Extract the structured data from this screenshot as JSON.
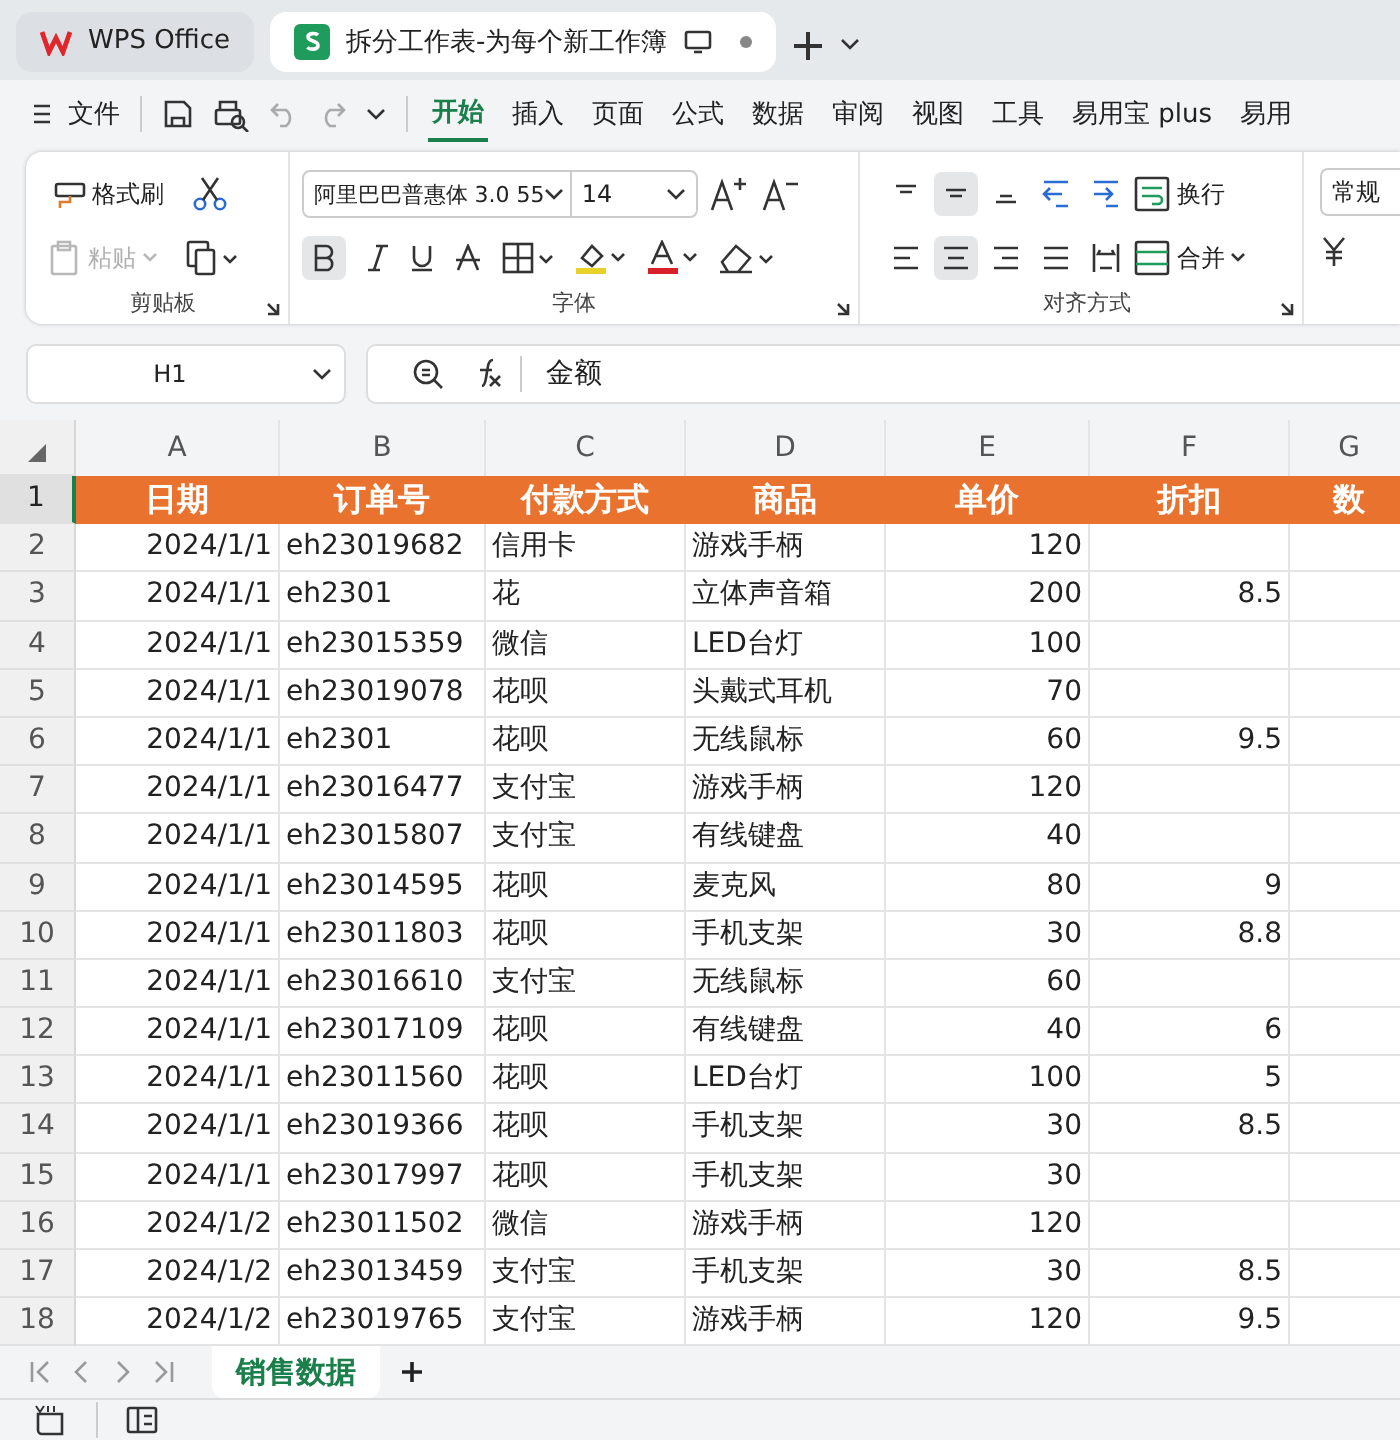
{
  "app_tabs": [
    {
      "label": "WPS Office",
      "kind": "home",
      "selected": false
    },
    {
      "label": "拆分工作表-为每个新工作簿",
      "kind": "sheet",
      "selected": true
    }
  ],
  "menu": "文件",
  "ribbon_tabs": [
    {
      "label": "开始",
      "selected": true
    },
    {
      "label": "插入",
      "selected": false
    },
    {
      "label": "页面",
      "selected": false
    },
    {
      "label": "公式",
      "selected": false
    },
    {
      "label": "数据",
      "selected": false
    },
    {
      "label": "审阅",
      "selected": false
    },
    {
      "label": "视图",
      "selected": false
    },
    {
      "label": "工具",
      "selected": false
    },
    {
      "label": "易用宝 plus",
      "selected": false
    },
    {
      "label": "易用",
      "selected": false
    }
  ],
  "clipboard": {
    "format_painter": "格式刷",
    "paste": "粘贴",
    "paste_disabled": true,
    "group": "剪贴板"
  },
  "font": {
    "name": "阿里巴巴普惠体 3.0 55",
    "size": "14",
    "bold": true,
    "group": "字体"
  },
  "alignment": {
    "top_row": [
      {
        "kind": "top",
        "selected": false
      },
      {
        "kind": "middle",
        "selected": true
      },
      {
        "kind": "bottom",
        "selected": false
      },
      {
        "kind": "outdent",
        "selected": false
      },
      {
        "kind": "indent",
        "selected": false
      }
    ],
    "bottom_row": [
      {
        "kind": "left",
        "selected": false
      },
      {
        "kind": "center",
        "selected": true
      },
      {
        "kind": "right",
        "selected": false
      },
      {
        "kind": "justify",
        "selected": false
      },
      {
        "kind": "distribute",
        "selected": false
      }
    ],
    "wrap": "换行",
    "merge": "合并",
    "group": "对齐方式"
  },
  "number": {
    "format": "常规"
  },
  "name_box": "H1",
  "formula": "金额",
  "columns": [
    "A",
    "B",
    "C",
    "D",
    "E",
    "F",
    "G"
  ],
  "header": {
    "n": "1",
    "cells": [
      "日期",
      "订单号",
      "付款方式",
      "商品",
      "单价",
      "折扣",
      "数"
    ]
  },
  "rows": [
    {
      "n": "2",
      "date": "2024/1/1",
      "order": "eh23019682",
      "pay": "信用卡",
      "item": "游戏手柄",
      "price": "120"
    },
    {
      "n": "3",
      "date": "2024/1/1",
      "order": "eh2301",
      "pay": "花",
      "item": "立体声音箱",
      "price": "200",
      "discount": "8.5"
    },
    {
      "n": "4",
      "date": "2024/1/1",
      "order": "eh23015359",
      "pay": "微信",
      "item": "LED台灯",
      "price": "100"
    },
    {
      "n": "5",
      "date": "2024/1/1",
      "order": "eh23019078",
      "pay": "花呗",
      "item": "头戴式耳机",
      "price": "70"
    },
    {
      "n": "6",
      "date": "2024/1/1",
      "order": "eh2301",
      "pay": "花呗",
      "item": "无线鼠标",
      "price": "60",
      "discount": "9.5"
    },
    {
      "n": "7",
      "date": "2024/1/1",
      "order": "eh23016477",
      "pay": "支付宝",
      "item": "游戏手柄",
      "price": "120"
    },
    {
      "n": "8",
      "date": "2024/1/1",
      "order": "eh23015807",
      "pay": "支付宝",
      "item": "有线键盘",
      "price": "40"
    },
    {
      "n": "9",
      "date": "2024/1/1",
      "order": "eh23014595",
      "pay": "花呗",
      "item": "麦克风",
      "price": "80",
      "discount": "9"
    },
    {
      "n": "10",
      "date": "2024/1/1",
      "order": "eh23011803",
      "pay": "花呗",
      "item": "手机支架",
      "price": "30",
      "discount": "8.8"
    },
    {
      "n": "11",
      "date": "2024/1/1",
      "order": "eh23016610",
      "pay": "支付宝",
      "item": "无线鼠标",
      "price": "60"
    },
    {
      "n": "12",
      "date": "2024/1/1",
      "order": "eh23017109",
      "pay": "花呗",
      "item": "有线键盘",
      "price": "40",
      "discount": "6"
    },
    {
      "n": "13",
      "date": "2024/1/1",
      "order": "eh23011560",
      "pay": "花呗",
      "item": "LED台灯",
      "price": "100",
      "discount": "5"
    },
    {
      "n": "14",
      "date": "2024/1/1",
      "order": "eh23019366",
      "pay": "花呗",
      "item": "手机支架",
      "price": "30",
      "discount": "8.5"
    },
    {
      "n": "15",
      "date": "2024/1/1",
      "order": "eh23017997",
      "pay": "花呗",
      "item": "手机支架",
      "price": "30"
    },
    {
      "n": "16",
      "date": "2024/1/2",
      "order": "eh23011502",
      "pay": "微信",
      "item": "游戏手柄",
      "price": "120"
    },
    {
      "n": "17",
      "date": "2024/1/2",
      "order": "eh23013459",
      "pay": "支付宝",
      "item": "手机支架",
      "price": "30",
      "discount": "8.5"
    },
    {
      "n": "18",
      "date": "2024/1/2",
      "order": "eh23019765",
      "pay": "支付宝",
      "item": "游戏手柄",
      "price": "120",
      "discount": "9.5"
    }
  ],
  "sheet_tabs": [
    {
      "label": "销售数据",
      "selected": true
    }
  ]
}
